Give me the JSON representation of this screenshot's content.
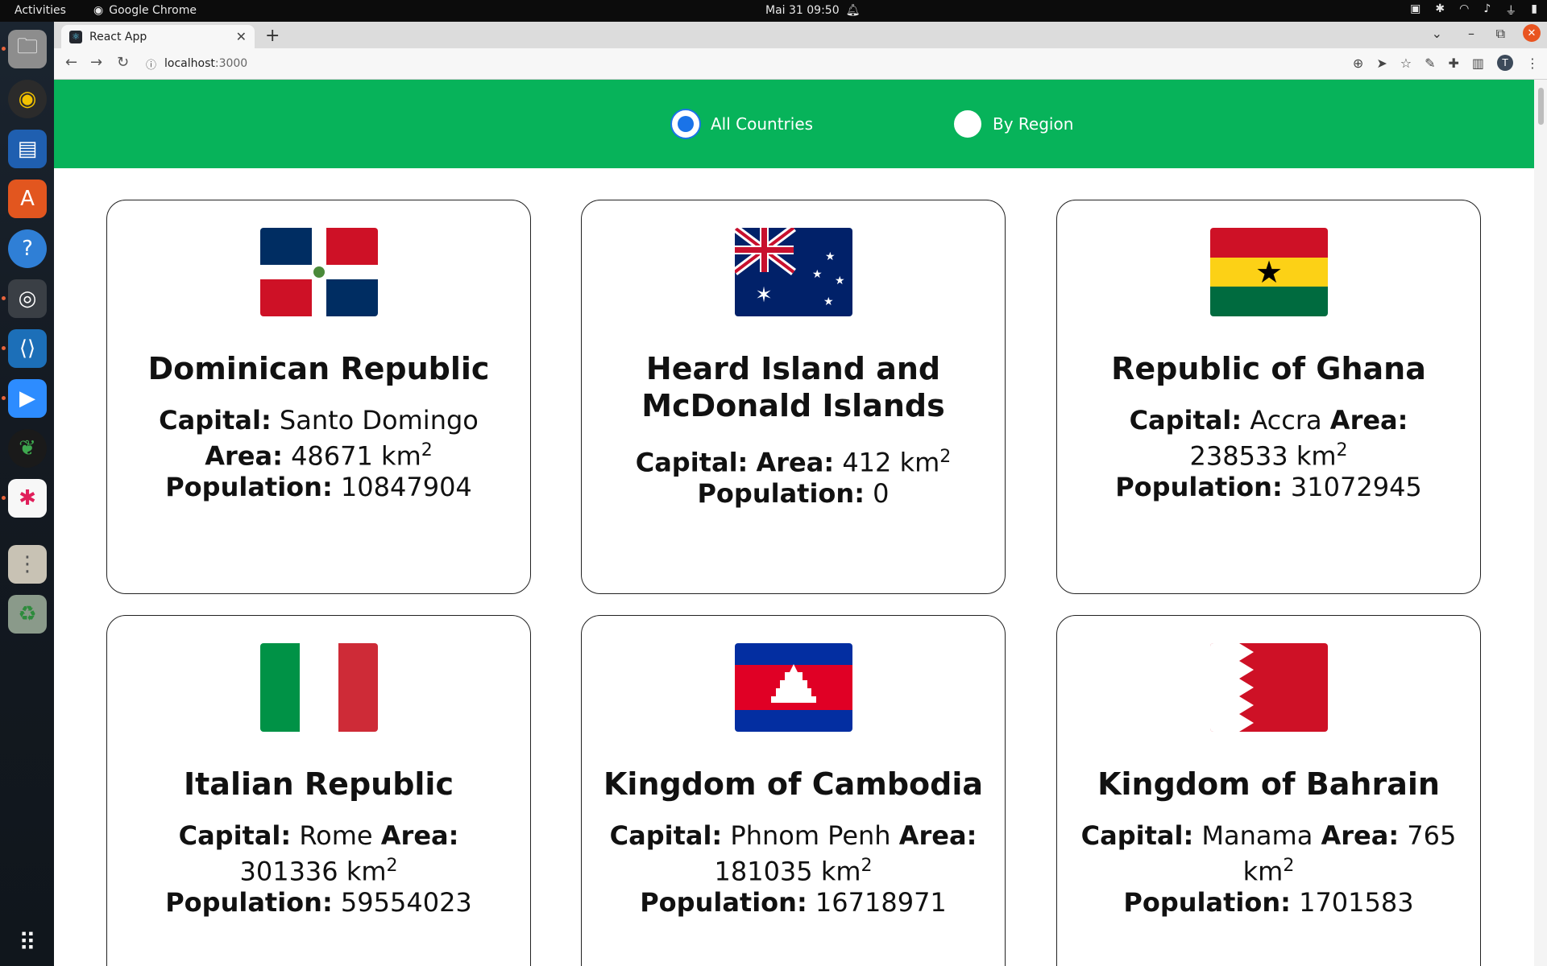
{
  "topbar": {
    "activities": "Activities",
    "app_name": "Google Chrome",
    "clock": "Mai 31  09:50"
  },
  "browser": {
    "tab_title": "React App",
    "url_host": "localhost",
    "url_port": ":3000"
  },
  "filter": {
    "options": [
      {
        "label": "All Countries",
        "checked": true
      },
      {
        "label": "By Region",
        "checked": false
      }
    ]
  },
  "labels": {
    "capital": "Capital:",
    "area": "Area:",
    "population": "Population:",
    "unit": "km",
    "unit_exp": "2"
  },
  "countries": [
    {
      "name": "Dominican Republic",
      "capital": "Santo Domingo",
      "area": "48671",
      "population": "10847904",
      "flag": "dominican-republic"
    },
    {
      "name": "Heard Island and McDonald Islands",
      "capital": "",
      "area": "412",
      "population": "0",
      "flag": "australia"
    },
    {
      "name": "Republic of Ghana",
      "capital": "Accra",
      "area": "238533",
      "population": "31072945",
      "flag": "ghana"
    },
    {
      "name": "Italian Republic",
      "capital": "Rome",
      "area": "301336",
      "population": "59554023",
      "flag": "italy"
    },
    {
      "name": "Kingdom of Cambodia",
      "capital": "Phnom Penh",
      "area": "181035",
      "population": "16718971",
      "flag": "cambodia"
    },
    {
      "name": "Kingdom of Bahrain",
      "capital": "Manama",
      "area": "765",
      "population": "1701583",
      "flag": "bahrain"
    }
  ],
  "colors": {
    "header_green": "#07b35a",
    "radio_blue": "#1a73e8"
  }
}
